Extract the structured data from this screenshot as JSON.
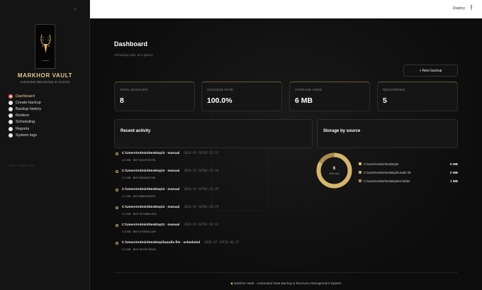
{
  "colors": {
    "accent": "#d6b56a",
    "sidebar_bg": "#141414",
    "main_bg": "#0d0d0d",
    "topbar_bg": "#ffffff",
    "active_radio": "#e24b4b"
  },
  "sidebar": {
    "collapse_icon": "double-chevron-left-icon",
    "brand": "MARKHOR VAULT",
    "tagline": "Automated data backup & recovery",
    "nav": [
      {
        "label": "Dashboard",
        "active": true
      },
      {
        "label": "Create backup",
        "active": false
      },
      {
        "label": "Backup history",
        "active": false
      },
      {
        "label": "Restore",
        "active": false
      },
      {
        "label": "Scheduling",
        "active": false
      },
      {
        "label": "Reports",
        "active": false
      },
      {
        "label": "System logs",
        "active": false
      }
    ],
    "footnote": "Data • Vault • Live"
  },
  "topbar": {
    "deploy_label": "Deploy",
    "menu_icon": "kebab-menu-icon"
  },
  "main": {
    "title": "Dashboard",
    "subtitle": "All backup jobs, at a glance",
    "new_backup_label": "+ New backup",
    "stats": [
      {
        "label": "TOTAL BACKUPS",
        "value": "8"
      },
      {
        "label": "SUCCESS RATE",
        "value": "100.0%"
      },
      {
        "label": "STORAGE USED",
        "value": "6 MB"
      },
      {
        "label": "RECOVERIES",
        "value": "5"
      }
    ],
    "recent_activity_title": "Recent activity",
    "storage_title": "Storage by source",
    "activity": [
      {
        "title": "C:\\Users\\Admin\\Desktop\\2 · manual",
        "time": "2026-07-10T02:15:57",
        "meta": "1.2 MB · BKP-6912F0257B"
      },
      {
        "title": "C:\\Users\\Admin\\Desktop\\2 · manual",
        "time": "2026-07-10T02:15:59",
        "meta": "1.2 MB · BKP-8928A9F255"
      },
      {
        "title": "C:\\Users\\Admin\\Desktop\\2 · manual",
        "time": "2026-07-10T02:11:29",
        "meta": "1.2 MB · BKP-B6E8398290"
      },
      {
        "title": "C:\\Users\\Admin\\Desktop\\2 · manual",
        "time": "2026-07-10T01:56:29",
        "meta": "0.4 MB · BKP-3F29BBCE3C"
      },
      {
        "title": "C:\\Users\\Admin\\Desktop\\2 · manual",
        "time": "2026-07-10T01:54:41",
        "meta": "0.4 MB · BKP-5796EEC34F"
      },
      {
        "title": "C:\\Users\\Admin\\Desktop\\huzaifa file · scheduled",
        "time": "2026-07-10T20:46:37",
        "meta": "0.0 MB · BKP-6F3FE7B080"
      }
    ],
    "donut": {
      "value": "6",
      "unit": "MB total"
    },
    "storage": [
      {
        "name": "C:\\Users\\Admin\\Desktop\\2",
        "value": "5 MB",
        "mb": 5,
        "color": "#d6b56a"
      },
      {
        "name": "C:\\Users\\Admin\\Desktop\\huzaifa file",
        "value": "0 MB",
        "mb": 0,
        "color": "#bfa66c"
      },
      {
        "name": "C:\\Users\\Admin\\Desktop\\test folder",
        "value": "1 MB",
        "mb": 1,
        "color": "#a88b4e"
      }
    ],
    "footer_icon": "shield-tag-icon",
    "footer": "Markhor Vault · Automated Data Backup & Recovery Management System"
  }
}
